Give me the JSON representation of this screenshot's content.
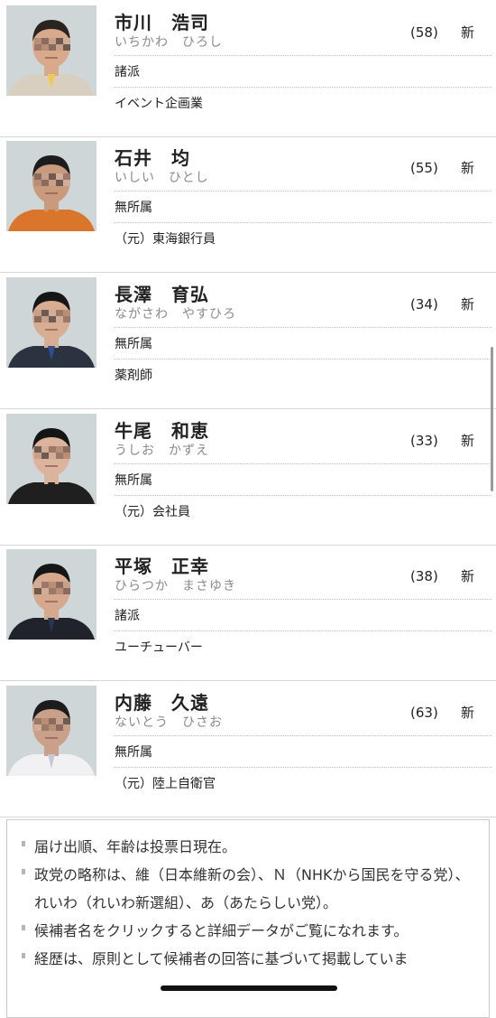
{
  "candidates": [
    {
      "name": "市川　浩司",
      "kana": "いちかわ　ひろし",
      "age": "(58)",
      "status": "新",
      "party": "諸派",
      "career": "イベント企画業",
      "photo": {
        "bg": "#cfd6d8",
        "skin": "#d8a98a",
        "hair": "#2a2420",
        "clothes": "#d8cfc0",
        "accent": "#f2c94c"
      }
    },
    {
      "name": "石井　均",
      "kana": "いしい　ひとし",
      "age": "(55)",
      "status": "新",
      "party": "無所属",
      "career": "（元）東海銀行員",
      "photo": {
        "bg": "#cfd6d8",
        "skin": "#c99a7c",
        "hair": "#1c1c1c",
        "clothes": "#d9762c",
        "accent": "#d9762c"
      }
    },
    {
      "name": "長澤　育弘",
      "kana": "ながさわ　やすひろ",
      "age": "(34)",
      "status": "新",
      "party": "無所属",
      "career": "薬剤師",
      "photo": {
        "bg": "#cfd6d8",
        "skin": "#d9ad91",
        "hair": "#161616",
        "clothes": "#2b3340",
        "accent": "#2f4f8f"
      }
    },
    {
      "name": "牛尾　和恵",
      "kana": "うしお　かずえ",
      "age": "(33)",
      "status": "新",
      "party": "無所属",
      "career": "（元）会社員",
      "photo": {
        "bg": "#cfd6d8",
        "skin": "#dcb39c",
        "hair": "#151515",
        "clothes": "#1f1f1f",
        "accent": "#1f1f1f"
      }
    },
    {
      "name": "平塚　正幸",
      "kana": "ひらつか　まさゆき",
      "age": "(38)",
      "status": "新",
      "party": "諸派",
      "career": "ユーチューバー",
      "photo": {
        "bg": "#cfd6d8",
        "skin": "#d6a98e",
        "hair": "#161616",
        "clothes": "#20232b",
        "accent": "#2a3550"
      }
    },
    {
      "name": "内藤　久遠",
      "kana": "ないとう　ひさお",
      "age": "(63)",
      "status": "新",
      "party": "無所属",
      "career": "（元）陸上自衛官",
      "photo": {
        "bg": "#cfd6d8",
        "skin": "#caa08a",
        "hair": "#1c1c1c",
        "clothes": "#f1f1f3",
        "accent": "#c8c8d8"
      }
    }
  ],
  "notes": [
    "届け出順、年齢は投票日現在。",
    "政党の略称は、維（日本維新の会）、Ｎ（NHKから国民を守る党）、れいわ（れいわ新選組）、あ（あたらしい党）。",
    "候補者名をクリックすると詳細データがご覧になれます。",
    "経歴は、原則として候補者の回答に基づいて掲載していま"
  ]
}
